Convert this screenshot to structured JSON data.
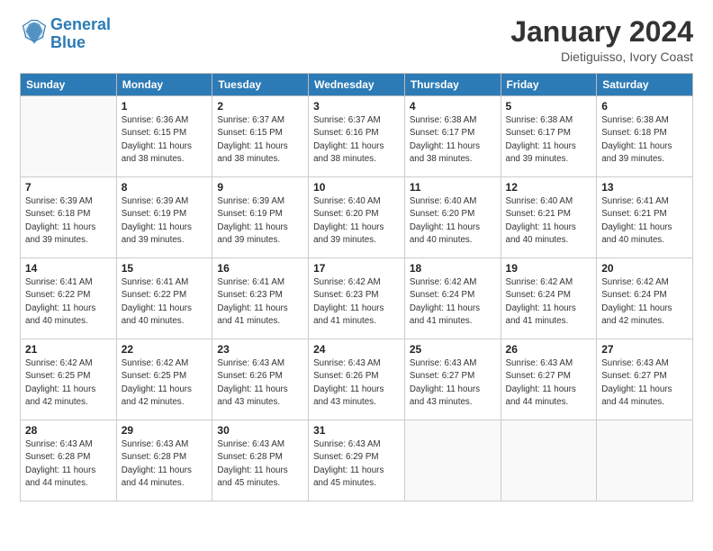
{
  "logo": {
    "line1": "General",
    "line2": "Blue"
  },
  "title": "January 2024",
  "subtitle": "Dietiguisso, Ivory Coast",
  "weekdays": [
    "Sunday",
    "Monday",
    "Tuesday",
    "Wednesday",
    "Thursday",
    "Friday",
    "Saturday"
  ],
  "weeks": [
    [
      {
        "day": "",
        "info": ""
      },
      {
        "day": "1",
        "info": "Sunrise: 6:36 AM\nSunset: 6:15 PM\nDaylight: 11 hours\nand 38 minutes."
      },
      {
        "day": "2",
        "info": "Sunrise: 6:37 AM\nSunset: 6:15 PM\nDaylight: 11 hours\nand 38 minutes."
      },
      {
        "day": "3",
        "info": "Sunrise: 6:37 AM\nSunset: 6:16 PM\nDaylight: 11 hours\nand 38 minutes."
      },
      {
        "day": "4",
        "info": "Sunrise: 6:38 AM\nSunset: 6:17 PM\nDaylight: 11 hours\nand 38 minutes."
      },
      {
        "day": "5",
        "info": "Sunrise: 6:38 AM\nSunset: 6:17 PM\nDaylight: 11 hours\nand 39 minutes."
      },
      {
        "day": "6",
        "info": "Sunrise: 6:38 AM\nSunset: 6:18 PM\nDaylight: 11 hours\nand 39 minutes."
      }
    ],
    [
      {
        "day": "7",
        "info": "Sunrise: 6:39 AM\nSunset: 6:18 PM\nDaylight: 11 hours\nand 39 minutes."
      },
      {
        "day": "8",
        "info": "Sunrise: 6:39 AM\nSunset: 6:19 PM\nDaylight: 11 hours\nand 39 minutes."
      },
      {
        "day": "9",
        "info": "Sunrise: 6:39 AM\nSunset: 6:19 PM\nDaylight: 11 hours\nand 39 minutes."
      },
      {
        "day": "10",
        "info": "Sunrise: 6:40 AM\nSunset: 6:20 PM\nDaylight: 11 hours\nand 39 minutes."
      },
      {
        "day": "11",
        "info": "Sunrise: 6:40 AM\nSunset: 6:20 PM\nDaylight: 11 hours\nand 40 minutes."
      },
      {
        "day": "12",
        "info": "Sunrise: 6:40 AM\nSunset: 6:21 PM\nDaylight: 11 hours\nand 40 minutes."
      },
      {
        "day": "13",
        "info": "Sunrise: 6:41 AM\nSunset: 6:21 PM\nDaylight: 11 hours\nand 40 minutes."
      }
    ],
    [
      {
        "day": "14",
        "info": "Sunrise: 6:41 AM\nSunset: 6:22 PM\nDaylight: 11 hours\nand 40 minutes."
      },
      {
        "day": "15",
        "info": "Sunrise: 6:41 AM\nSunset: 6:22 PM\nDaylight: 11 hours\nand 40 minutes."
      },
      {
        "day": "16",
        "info": "Sunrise: 6:41 AM\nSunset: 6:23 PM\nDaylight: 11 hours\nand 41 minutes."
      },
      {
        "day": "17",
        "info": "Sunrise: 6:42 AM\nSunset: 6:23 PM\nDaylight: 11 hours\nand 41 minutes."
      },
      {
        "day": "18",
        "info": "Sunrise: 6:42 AM\nSunset: 6:24 PM\nDaylight: 11 hours\nand 41 minutes."
      },
      {
        "day": "19",
        "info": "Sunrise: 6:42 AM\nSunset: 6:24 PM\nDaylight: 11 hours\nand 41 minutes."
      },
      {
        "day": "20",
        "info": "Sunrise: 6:42 AM\nSunset: 6:24 PM\nDaylight: 11 hours\nand 42 minutes."
      }
    ],
    [
      {
        "day": "21",
        "info": "Sunrise: 6:42 AM\nSunset: 6:25 PM\nDaylight: 11 hours\nand 42 minutes."
      },
      {
        "day": "22",
        "info": "Sunrise: 6:42 AM\nSunset: 6:25 PM\nDaylight: 11 hours\nand 42 minutes."
      },
      {
        "day": "23",
        "info": "Sunrise: 6:43 AM\nSunset: 6:26 PM\nDaylight: 11 hours\nand 43 minutes."
      },
      {
        "day": "24",
        "info": "Sunrise: 6:43 AM\nSunset: 6:26 PM\nDaylight: 11 hours\nand 43 minutes."
      },
      {
        "day": "25",
        "info": "Sunrise: 6:43 AM\nSunset: 6:27 PM\nDaylight: 11 hours\nand 43 minutes."
      },
      {
        "day": "26",
        "info": "Sunrise: 6:43 AM\nSunset: 6:27 PM\nDaylight: 11 hours\nand 44 minutes."
      },
      {
        "day": "27",
        "info": "Sunrise: 6:43 AM\nSunset: 6:27 PM\nDaylight: 11 hours\nand 44 minutes."
      }
    ],
    [
      {
        "day": "28",
        "info": "Sunrise: 6:43 AM\nSunset: 6:28 PM\nDaylight: 11 hours\nand 44 minutes."
      },
      {
        "day": "29",
        "info": "Sunrise: 6:43 AM\nSunset: 6:28 PM\nDaylight: 11 hours\nand 44 minutes."
      },
      {
        "day": "30",
        "info": "Sunrise: 6:43 AM\nSunset: 6:28 PM\nDaylight: 11 hours\nand 45 minutes."
      },
      {
        "day": "31",
        "info": "Sunrise: 6:43 AM\nSunset: 6:29 PM\nDaylight: 11 hours\nand 45 minutes."
      },
      {
        "day": "",
        "info": ""
      },
      {
        "day": "",
        "info": ""
      },
      {
        "day": "",
        "info": ""
      }
    ]
  ]
}
